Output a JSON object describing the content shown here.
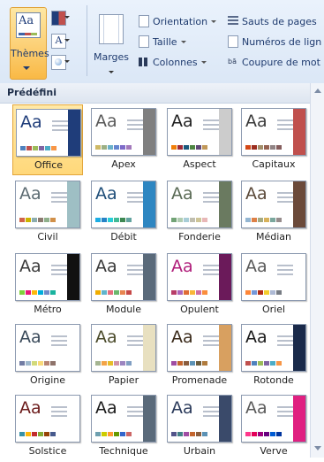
{
  "ribbon": {
    "themes": {
      "label": "Thèmes",
      "icon": "themes-icon"
    },
    "colors_btn": {
      "icon": "theme-colors-icon"
    },
    "fonts_btn": {
      "icon": "theme-fonts-icon",
      "glyph": "A"
    },
    "effects_btn": {
      "icon": "theme-effects-icon"
    },
    "marges": {
      "label": "Marges",
      "icon": "margins-icon"
    },
    "orientation": {
      "label": "Orientation",
      "icon": "orientation-icon"
    },
    "taille": {
      "label": "Taille",
      "icon": "size-icon"
    },
    "colonnes": {
      "label": "Colonnes",
      "icon": "columns-icon"
    },
    "sauts": {
      "label": "Sauts de pages",
      "icon": "page-breaks-icon"
    },
    "numeros": {
      "label": "Numéros de lign",
      "icon": "line-numbers-icon"
    },
    "coupure": {
      "label": "Coupure de mot",
      "icon": "hyphenation-icon"
    }
  },
  "gallery": {
    "section_title": "Prédéfini",
    "themes": [
      {
        "name": "Office",
        "selected": true,
        "aa": "Aa",
        "text_color": "#1f3d7a",
        "accent": "#1f3d7a",
        "colors": [
          "#4f81bd",
          "#c0504d",
          "#9bbb59",
          "#8064a2",
          "#4bacc6",
          "#f79646"
        ]
      },
      {
        "name": "Apex",
        "aa": "Aa",
        "text_color": "#5a5a5a",
        "accent": "#7f7f7f",
        "colors": [
          "#ceb966",
          "#9cb084",
          "#6bb1c9",
          "#6585cf",
          "#7e6bc9",
          "#a379bb"
        ]
      },
      {
        "name": "Aspect",
        "aa": "Aa",
        "text_color": "#1f1f1f",
        "accent": "#cccccc",
        "colors": [
          "#f07f09",
          "#9f2936",
          "#1b587c",
          "#4e8542",
          "#604878",
          "#c19859"
        ]
      },
      {
        "name": "Capitaux",
        "aa": "Aa",
        "text_color": "#3b3b3b",
        "accent": "#c0504d",
        "colors": [
          "#d34817",
          "#9b2d1f",
          "#a28e6a",
          "#956251",
          "#918485",
          "#855d5d"
        ]
      },
      {
        "name": "Civil",
        "aa": "Aa",
        "text_color": "#5d6c73",
        "accent": "#9ebfc4",
        "colors": [
          "#d16349",
          "#ccb400",
          "#8cadae",
          "#8c7b70",
          "#8fb08c",
          "#d19049"
        ]
      },
      {
        "name": "Débit",
        "aa": "Aa",
        "text_color": "#1f4e79",
        "accent": "#2e86c1",
        "colors": [
          "#1cade4",
          "#2683c6",
          "#27ced7",
          "#42ba97",
          "#3e8853",
          "#62a39f"
        ]
      },
      {
        "name": "Fonderie",
        "aa": "Aa",
        "text_color": "#5a6a55",
        "accent": "#6a7a60",
        "colors": [
          "#72a376",
          "#b0ccb0",
          "#a8cdd7",
          "#c0beaf",
          "#cec597",
          "#e8b7b7"
        ]
      },
      {
        "name": "Médian",
        "aa": "Aa",
        "text_color": "#5b4a3a",
        "accent": "#6b4a3a",
        "colors": [
          "#94b6d2",
          "#dd8047",
          "#a5ab81",
          "#d8b25c",
          "#7ba79d",
          "#968c8c"
        ]
      },
      {
        "name": "Métro",
        "aa": "Aa",
        "text_color": "#3a3a3a",
        "accent": "#111111",
        "colors": [
          "#7fd13b",
          "#ea157a",
          "#feb80a",
          "#00addc",
          "#738ac8",
          "#1ab39f"
        ]
      },
      {
        "name": "Module",
        "aa": "Aa",
        "text_color": "#3a3a3a",
        "accent": "#5a6a7a",
        "colors": [
          "#f0ad00",
          "#60b5cc",
          "#e66c7d",
          "#6bb76d",
          "#e88651",
          "#c64847"
        ]
      },
      {
        "name": "Opulent",
        "aa": "Aa",
        "text_color": "#b01e7a",
        "accent": "#6b1a5a",
        "colors": [
          "#b83d68",
          "#ac66bb",
          "#de6c36",
          "#f9b639",
          "#cf6da4",
          "#fa8d3d"
        ]
      },
      {
        "name": "Oriel",
        "aa": "Aa",
        "text_color": "#5a5a5a",
        "accent": "#ffffff",
        "colors": [
          "#fe8637",
          "#7598d9",
          "#b32c16",
          "#f5cd2d",
          "#aebad5",
          "#777c84"
        ]
      },
      {
        "name": "Origine",
        "aa": "Aa",
        "text_color": "#3a4a5a",
        "accent": "#ffffff",
        "colors": [
          "#727ca3",
          "#9fb8cd",
          "#d2da7a",
          "#fada7a",
          "#b88472",
          "#8e736a"
        ]
      },
      {
        "name": "Papier",
        "aa": "Aa",
        "text_color": "#4a4a2a",
        "accent": "#e8e0c0",
        "colors": [
          "#a5b592",
          "#f3a447",
          "#e7bc29",
          "#d092a7",
          "#9c85c0",
          "#809ec2"
        ]
      },
      {
        "name": "Promenade",
        "aa": "Aa",
        "text_color": "#3a2a1a",
        "accent": "#d8a060",
        "colors": [
          "#a04da3",
          "#c4652d",
          "#8b5d3d",
          "#5c92b5",
          "#6a5d3d",
          "#b07b3d"
        ]
      },
      {
        "name": "Rotonde",
        "aa": "Aa",
        "text_color": "#1a1a1a",
        "accent": "#1a2a4a",
        "colors": [
          "#c0504d",
          "#4f81bd",
          "#9bbb59",
          "#8064a2",
          "#4bacc6",
          "#f79646"
        ]
      },
      {
        "name": "Solstice",
        "aa": "Aa",
        "text_color": "#6b1a1a",
        "accent": "#ffffff",
        "colors": [
          "#3891a7",
          "#feb80a",
          "#c32d2e",
          "#84aa33",
          "#964305",
          "#475a8d"
        ]
      },
      {
        "name": "Technique",
        "aa": "Aa",
        "text_color": "#1a1a1a",
        "accent": "#5a6a7a",
        "colors": [
          "#6ea0b0",
          "#cccc00",
          "#ff9933",
          "#669900",
          "#3366cc",
          "#cc6666"
        ]
      },
      {
        "name": "Urbain",
        "aa": "Aa",
        "text_color": "#2a3a5a",
        "accent": "#3a4a6a",
        "colors": [
          "#53548a",
          "#438086",
          "#a04da3",
          "#c4652d",
          "#8b5d3d",
          "#5c92b5"
        ]
      },
      {
        "name": "Verve",
        "aa": "Aa",
        "text_color": "#5a5a5a",
        "accent": "#e02080",
        "colors": [
          "#ff388c",
          "#e40059",
          "#9c007f",
          "#68007f",
          "#005bd3",
          "#00349e"
        ]
      }
    ]
  }
}
